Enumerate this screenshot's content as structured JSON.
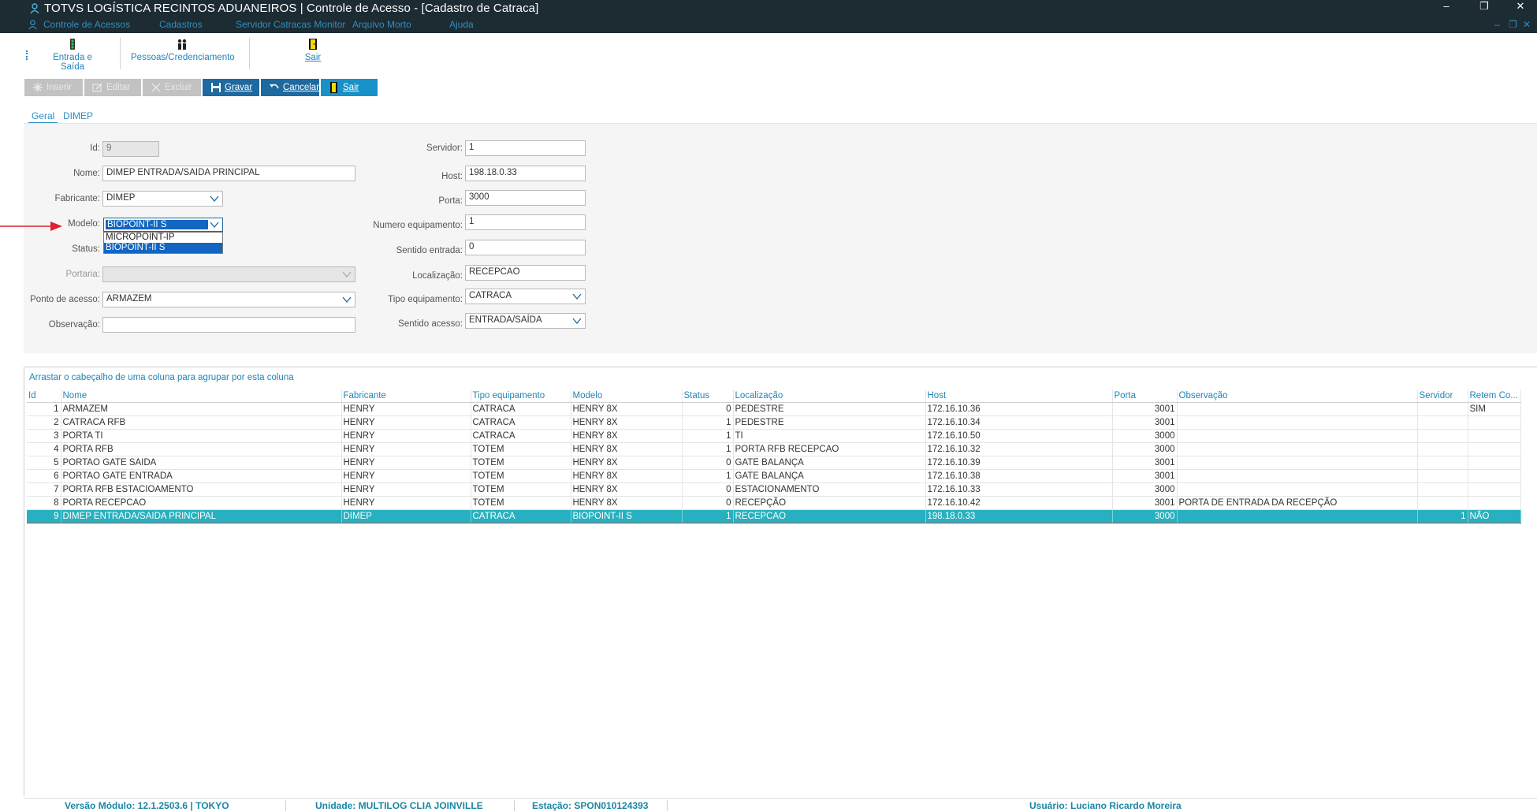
{
  "window": {
    "title": "TOTVS LOGÍSTICA RECINTOS ADUANEIROS | Controle de Acesso - [Cadastro de Catraca]",
    "controls": {
      "minimize": "–",
      "restore": "❐",
      "close": "✕",
      "mdi_minimize": "–",
      "mdi_restore": "❐",
      "mdi_close": "✕"
    }
  },
  "menu": [
    "Controle de Acessos",
    "Cadastros",
    "Servidor Catracas Monitor",
    "Arquivo Morto",
    "Ajuda"
  ],
  "toolbar": [
    {
      "label": "Entrada e Saída",
      "icon": "traffic-light-icon"
    },
    {
      "label": "Pessoas/Credenciamento",
      "icon": "people-icon"
    },
    {
      "label": "Sair",
      "icon": "exit-door-icon"
    }
  ],
  "actions": {
    "inserir": "Inserir",
    "editar": "Editar",
    "excluir": "Excluir",
    "gravar": "Gravar",
    "cancelar": "Cancelar",
    "sair": "Sair"
  },
  "tabs": [
    "Geral",
    "DIMEP"
  ],
  "form": {
    "id": {
      "label": "Id:",
      "value": "9"
    },
    "nome": {
      "label": "Nome:",
      "value": "DIMEP ENTRADA/SAIDA PRINCIPAL"
    },
    "fabricante": {
      "label": "Fabricante:",
      "value": "DIMEP"
    },
    "modelo": {
      "label": "Modelo:",
      "value": "BIOPOINT-II S",
      "options": [
        "MICROPOINT-IP",
        "BIOPOINT-II S"
      ]
    },
    "status": {
      "label": "Status:"
    },
    "portaria": {
      "label": "Portaria:",
      "value": ""
    },
    "ponto_acesso": {
      "label": "Ponto de acesso:",
      "value": "ARMAZEM"
    },
    "observacao": {
      "label": "Observação:",
      "value": ""
    },
    "servidor": {
      "label": "Servidor:",
      "value": "1"
    },
    "host": {
      "label": "Host:",
      "value": "198.18.0.33"
    },
    "porta": {
      "label": "Porta:",
      "value": "3000"
    },
    "numero_equipamento": {
      "label": "Numero equipamento:",
      "value": "1"
    },
    "sentido_entrada": {
      "label": "Sentido entrada:",
      "value": "0"
    },
    "localizacao": {
      "label": "Localização:",
      "value": "RECEPCAO"
    },
    "tipo_equipamento": {
      "label": "Tipo equipamento:",
      "value": "CATRACA"
    },
    "sentido_acesso": {
      "label": "Sentido acesso:",
      "value": "ENTRADA/SAÍDA"
    }
  },
  "grid": {
    "group_hint": "Arrastar o cabeçalho de uma coluna para agrupar por esta coluna",
    "columns": [
      "Id",
      "Nome",
      "Fabricante",
      "Tipo equipamento",
      "Modelo",
      "Status",
      "Localização",
      "Host",
      "Porta",
      "Observação",
      "Servidor",
      "Retem Co..."
    ],
    "rows": [
      [
        "1",
        "ARMAZEM",
        "HENRY",
        "CATRACA",
        "HENRY 8X",
        "0",
        "PEDESTRE",
        "172.16.10.36",
        "3001",
        "",
        "",
        "SIM"
      ],
      [
        "2",
        "CATRACA RFB",
        "HENRY",
        "CATRACA",
        "HENRY 8X",
        "1",
        "PEDESTRE",
        "172.16.10.34",
        "3001",
        "",
        "",
        ""
      ],
      [
        "3",
        "PORTA TI",
        "HENRY",
        "CATRACA",
        "HENRY 8X",
        "1",
        "TI",
        "172.16.10.50",
        "3000",
        "",
        "",
        ""
      ],
      [
        "4",
        "PORTA RFB",
        "HENRY",
        "TOTEM",
        "HENRY 8X",
        "1",
        "PORTA RFB RECEPCAO",
        "172.16.10.32",
        "3000",
        "",
        "",
        ""
      ],
      [
        "5",
        "PORTAO GATE SAIDA",
        "HENRY",
        "TOTEM",
        "HENRY 8X",
        "0",
        "GATE BALANÇA",
        "172.16.10.39",
        "3001",
        "",
        "",
        ""
      ],
      [
        "6",
        "PORTAO GATE ENTRADA",
        "HENRY",
        "TOTEM",
        "HENRY 8X",
        "1",
        "GATE BALANÇA",
        "172.16.10.38",
        "3001",
        "",
        "",
        ""
      ],
      [
        "7",
        "PORTA RFB ESTACIOAMENTO",
        "HENRY",
        "TOTEM",
        "HENRY 8X",
        "0",
        "ESTACIONAMENTO",
        "172.16.10.33",
        "3000",
        "",
        "",
        ""
      ],
      [
        "8",
        "PORTA RECEPCAO",
        "HENRY",
        "TOTEM",
        "HENRY 8X",
        "0",
        "RECEPÇÃO",
        "172.16.10.42",
        "3001",
        "PORTA DE ENTRADA DA RECEPÇÃO",
        "",
        ""
      ],
      [
        "9",
        "DIMEP ENTRADA/SAIDA PRINCIPAL",
        "DIMEP",
        "CATRACA",
        "BIOPOINT-II S",
        "1",
        "RECEPCAO",
        "198.18.0.33",
        "3000",
        "",
        "1",
        "NÃO"
      ]
    ],
    "selected_row": 8
  },
  "statusbar": {
    "versao": "Versão Módulo:   12.1.2503.6  |  TOKYO",
    "unidade": "Unidade:  MULTILOG CLIA JOINVILLE",
    "estacao": "Estação:  SPON010124393",
    "usuario": "Usuário:  Luciano Ricardo Moreira"
  },
  "colors": {
    "accent": "#1f86b8",
    "titlebar": "#1d2b33",
    "selected_row": "#27b0bf",
    "highlight": "#1266c2",
    "arrow": "#d9232e"
  }
}
